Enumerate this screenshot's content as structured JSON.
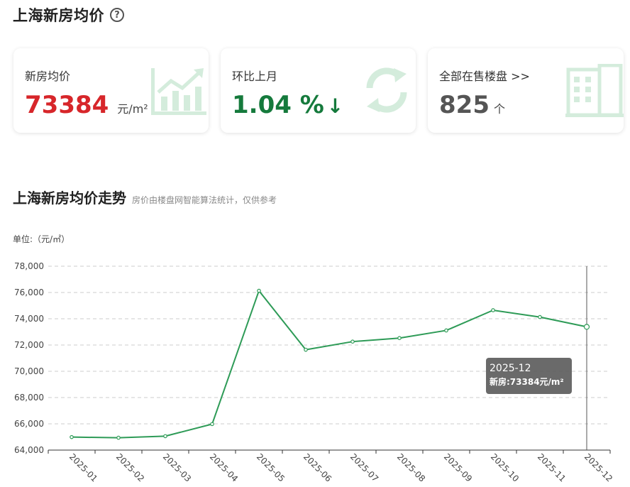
{
  "header": {
    "title": "上海新房均价"
  },
  "cards": {
    "avg_price": {
      "label": "新房均价",
      "value": "73384",
      "unit": "元/m²",
      "value_color": "#d7262a"
    },
    "mom": {
      "label": "环比上月",
      "value": "1.04 %",
      "arrow": "↓",
      "value_color": "#157a3c"
    },
    "on_sale": {
      "label": "全部在售楼盘 >>",
      "value": "825",
      "unit": "个",
      "value_color": "#555555"
    }
  },
  "section": {
    "title": "上海新房均价走势",
    "subtitle": "房价由楼盘网智能算法统计，仅供参考",
    "unit_label": "单位:（元/㎡）"
  },
  "tooltip": {
    "date": "2025-12",
    "text": "新房:73384元/m²"
  },
  "colors": {
    "line": "#2e9b57",
    "icon_green": "#d4ecdc",
    "grid": "#cccccc"
  },
  "chart_data": {
    "type": "line",
    "categories": [
      "2025-01",
      "2025-02",
      "2025-03",
      "2025-04",
      "2025-05",
      "2025-06",
      "2025-07",
      "2025-08",
      "2025-09",
      "2025-10",
      "2025-11",
      "2025-12"
    ],
    "series": [
      {
        "name": "新房",
        "values": [
          64990,
          64940,
          65060,
          65980,
          76130,
          71640,
          72260,
          72530,
          73110,
          74650,
          74130,
          73384
        ]
      }
    ],
    "ylim": [
      64000,
      78000
    ],
    "yticks": [
      "64,000",
      "66,000",
      "68,000",
      "70,000",
      "72,000",
      "74,000",
      "76,000",
      "78,000"
    ],
    "ytick_values": [
      64000,
      66000,
      68000,
      70000,
      72000,
      74000,
      76000,
      78000
    ],
    "grid": true,
    "highlight_index": 11
  }
}
